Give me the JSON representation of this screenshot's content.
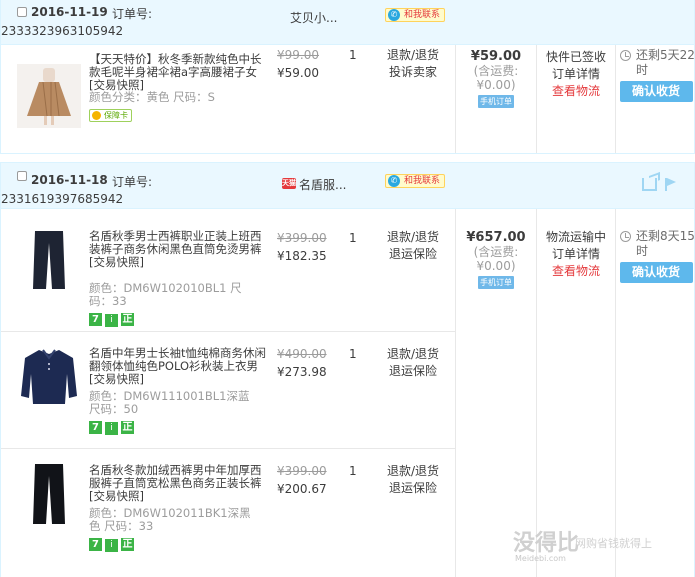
{
  "orders": [
    {
      "date": "2016-11-19",
      "order_label": "订单号:",
      "order_number": "2333323963105942",
      "shop_name": "艾贝小...",
      "chat_label": "和我联系",
      "items": [
        {
          "title": "【天天特价】秋冬季新款纯色中长款毛呢半身裙伞裙a字高腰裙子女 [交易快照]",
          "props": "颜色分类：黄色 尺码：S",
          "guard_label": "保障卡",
          "orig_price": "¥99.00",
          "price": "¥59.00",
          "qty": "1",
          "svc1": "退款/退货",
          "svc2": "投诉卖家"
        }
      ],
      "total": "¥59.00",
      "ship_label": "(含运费:",
      "ship_value": "¥0.00)",
      "mobile_label": "手机订单",
      "status1": "快件已签收",
      "status2": "订单详情",
      "status3": "查看物流",
      "remain": "还剩5天22时",
      "confirm": "确认收货"
    },
    {
      "date": "2016-11-18",
      "order_label": "订单号:",
      "order_number": "2331619397685942",
      "shop_icon": "天猫",
      "shop_name": "名盾服...",
      "chat_label": "和我联系",
      "items": [
        {
          "title": "名盾秋季男士西裤职业正装上班西装裤子商务休闲黑色直筒免烫男裤 [交易快照]",
          "props": "颜色：DM6W102010BL1 尺码：33",
          "badge_7": "7",
          "badge_i": "i",
          "badge_z": "正",
          "orig_price": "¥399.00",
          "price": "¥182.35",
          "qty": "1",
          "svc1": "退款/退货",
          "svc2": "退运保险"
        },
        {
          "title": "名盾中年男士长袖t恤纯棉商务休闲翻领体恤纯色POLO衫秋装上衣男 [交易快照]",
          "props": "颜色：DM6W111001BL1深蓝 尺码：50",
          "badge_7": "7",
          "badge_i": "i",
          "badge_z": "正",
          "orig_price": "¥490.00",
          "price": "¥273.98",
          "qty": "1",
          "svc1": "退款/退货",
          "svc2": "退运保险"
        },
        {
          "title": "名盾秋冬款加绒西裤男中年加厚西服裤子直筒宽松黑色商务正装长裤 [交易快照]",
          "props": "颜色：DM6W102011BK1深黑色 尺码：33",
          "badge_7": "7",
          "badge_i": "i",
          "badge_z": "正",
          "orig_price": "¥399.00",
          "price": "¥200.67",
          "qty": "1",
          "svc1": "退款/退货",
          "svc2": "退运保险"
        }
      ],
      "total": "¥657.00",
      "ship_label": "(含运费:",
      "ship_value": "¥0.00)",
      "mobile_label": "手机订单",
      "status1": "物流运输中",
      "status2": "订单详情",
      "status3": "查看物流",
      "remain": "还剩8天15时",
      "confirm": "确认收货"
    }
  ],
  "watermark": {
    "big": "没得比",
    "small": "Meidebi.com",
    "tag": "网购省钱就得上"
  }
}
